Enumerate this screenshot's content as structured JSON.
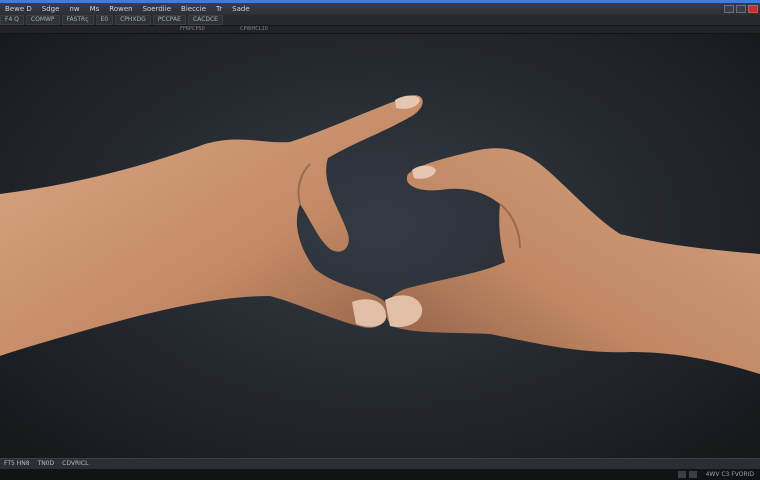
{
  "window": {
    "menu": [
      "Bewe D",
      "Sdge",
      "nw",
      "Ms",
      "Rowen",
      "Soerdiie",
      "Bieccie",
      "Tr",
      "Sade"
    ]
  },
  "toolbar": {
    "tools": [
      "F4 Q",
      "COMWP",
      "FASTRç",
      "E0",
      "CPHXDG",
      "PCCPAE",
      "CACDCE"
    ]
  },
  "ruler": {
    "labels": [
      "FF6PCPS0",
      "CPWHCL10"
    ]
  },
  "status": {
    "items": [
      "FT5 HN8",
      "TN0D",
      "CDVRICL"
    ]
  },
  "taskbar": {
    "clock": "4WV C3 FVORID"
  },
  "canvas": {
    "image": "two-hands-reaching-touch"
  }
}
